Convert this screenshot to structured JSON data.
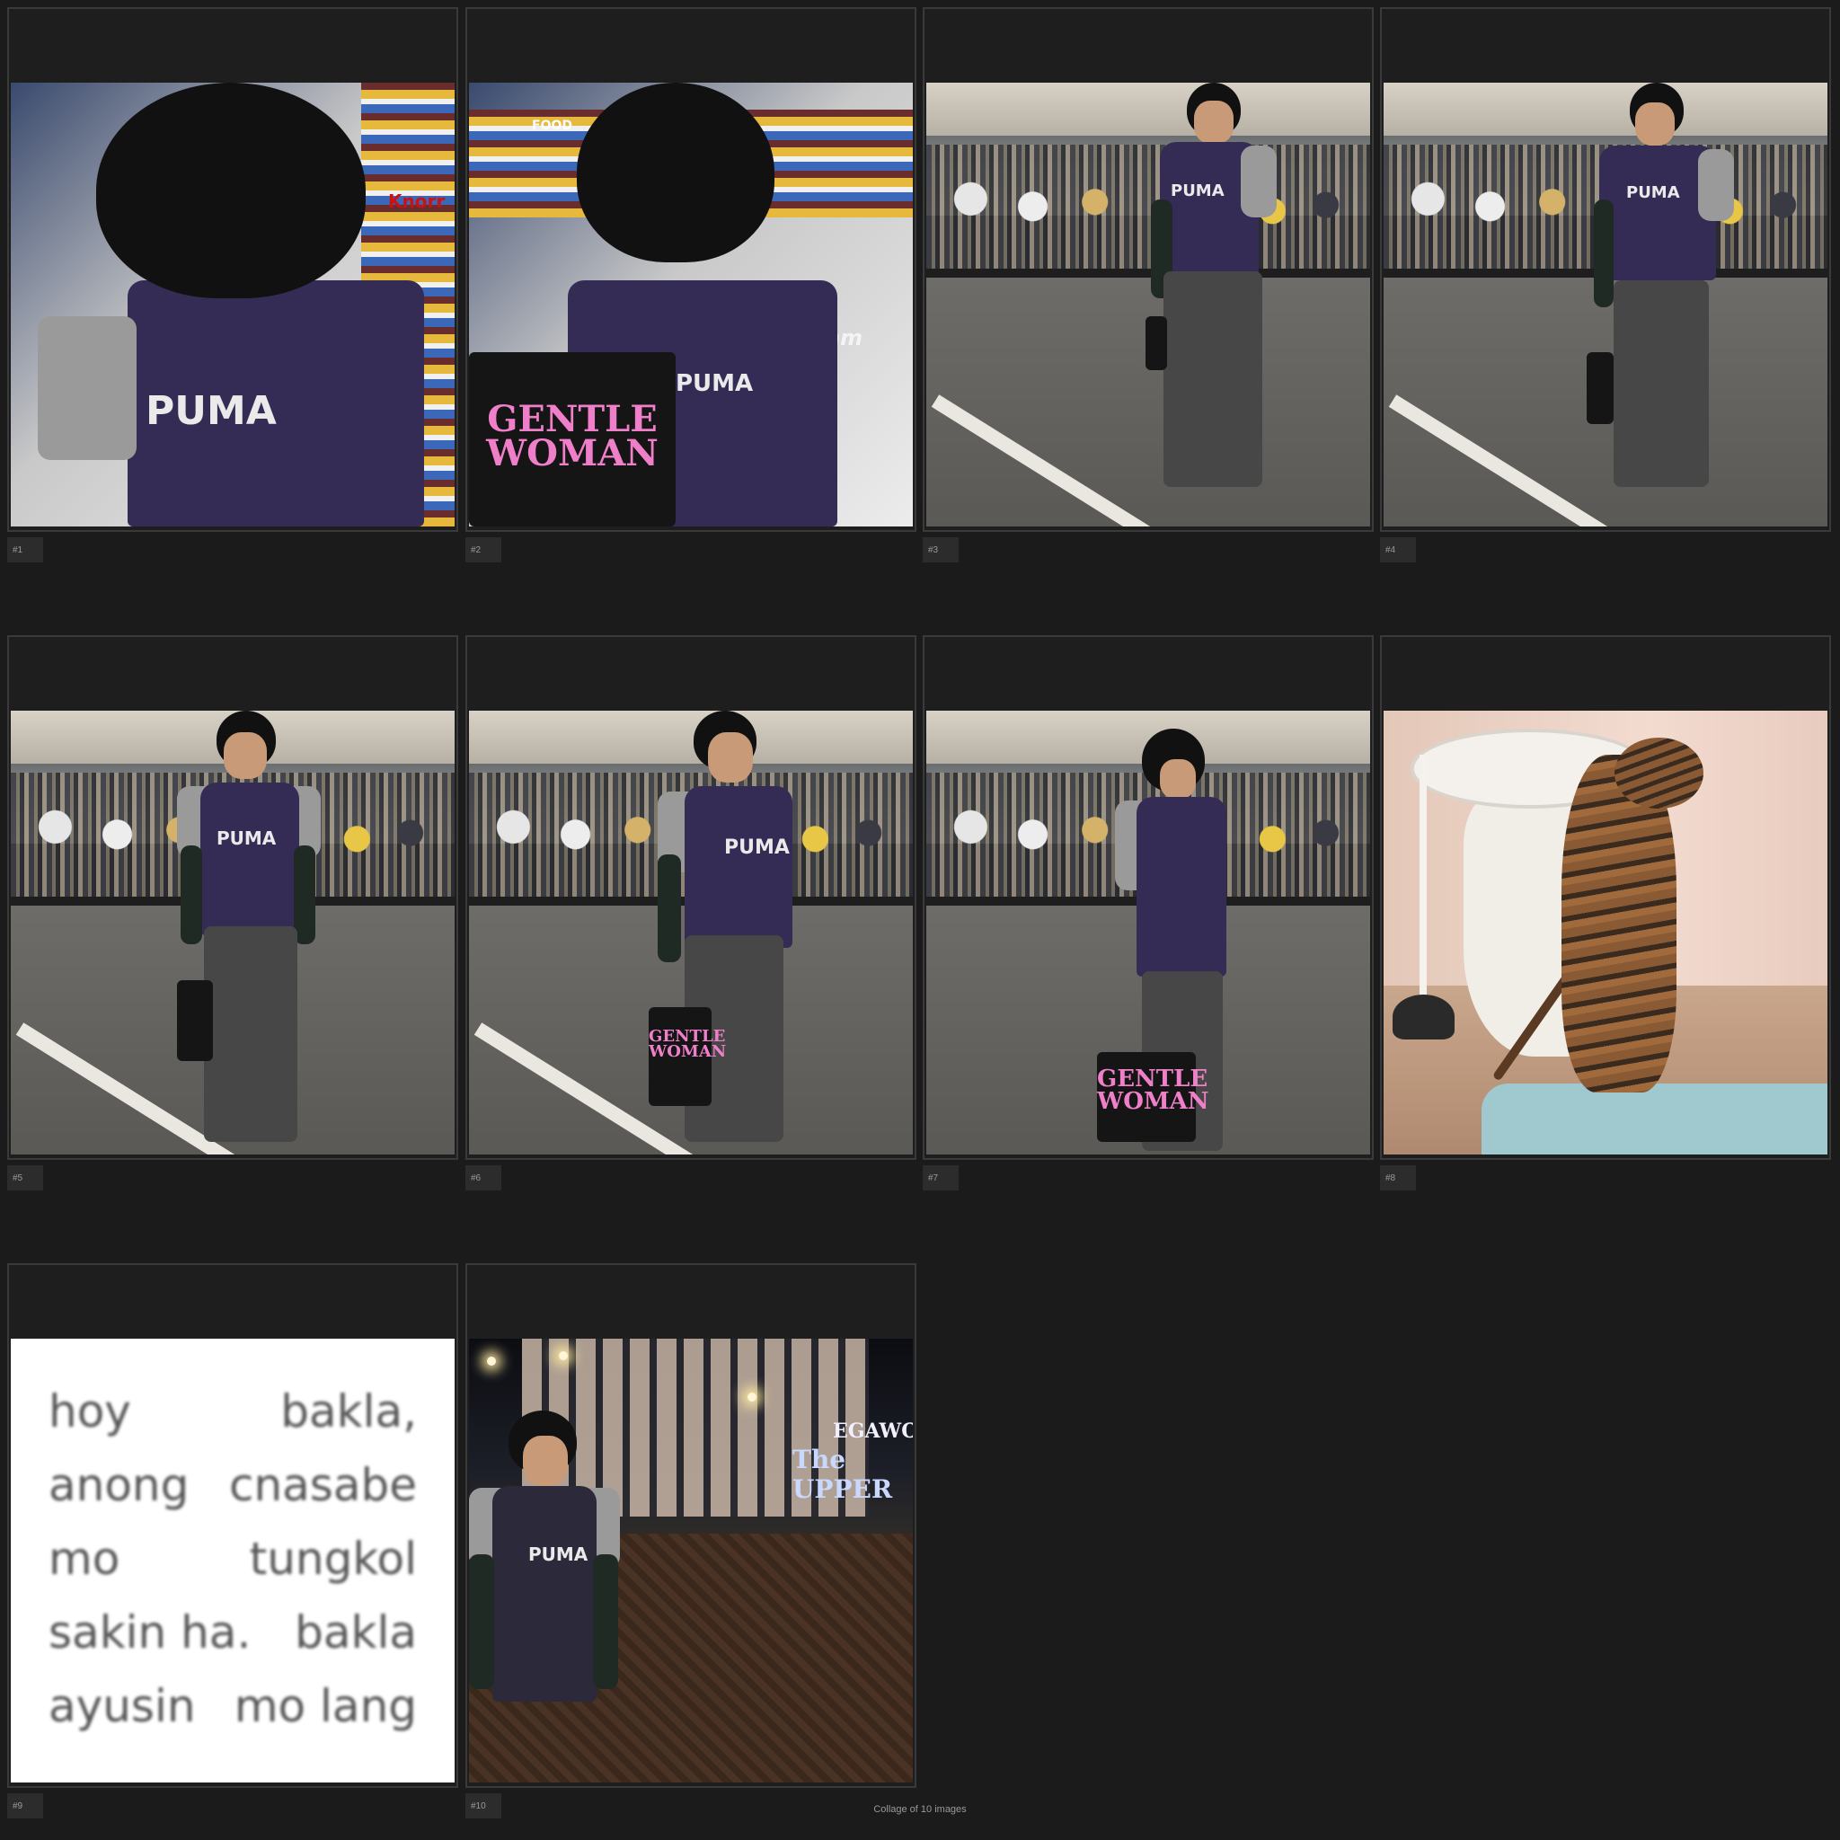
{
  "collage": {
    "caption": "Collage of 10 images",
    "tiles": [
      {
        "index": "#1"
      },
      {
        "index": "#2"
      },
      {
        "index": "#3"
      },
      {
        "index": "#4"
      },
      {
        "index": "#5"
      },
      {
        "index": "#6"
      },
      {
        "index": "#7"
      },
      {
        "index": "#8"
      },
      {
        "index": "#9"
      },
      {
        "index": "#10"
      }
    ]
  },
  "photo_text": {
    "shirt_logo": "PUMA",
    "bag_line1": "GENTLE",
    "bag_line2": "WOMAN",
    "store_sign": "FOOD",
    "freezer_text": "e cream",
    "brand_knorr": "Knorr",
    "sign_megaworld": "EGAWOR",
    "sign_upper": "The UPPER"
  },
  "text_tile": {
    "lines": [
      [
        "hoy",
        "bakla,"
      ],
      [
        "anong",
        "cnasabe"
      ],
      [
        "mo",
        "tungkol"
      ],
      [
        "sakin ha.",
        "bakla"
      ],
      [
        "ayusin",
        "mo lang"
      ]
    ]
  },
  "colors": {
    "background": "#1b1b1b",
    "shirt": "#352c55",
    "bag_text": "#f07fc9"
  }
}
